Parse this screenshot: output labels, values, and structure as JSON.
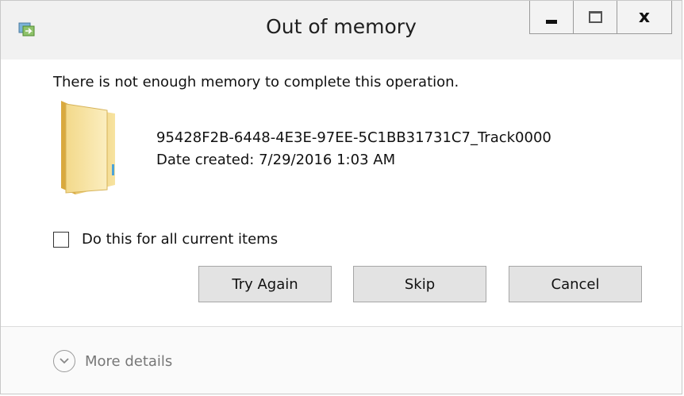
{
  "window": {
    "title": "Out of memory",
    "app_icon": "copy-transfer-icon"
  },
  "caption_buttons": {
    "minimize_icon": "minimize-icon",
    "maximize_icon": "maximize-icon",
    "close_label": "x"
  },
  "body": {
    "message": "There is not enough memory to complete this operation.",
    "file_icon": "folder-icon",
    "file_name": "95428F2B-6448-4E3E-97EE-5C1BB31731C7_Track0000",
    "date_created": "Date created: 7/29/2016 1:03 AM"
  },
  "options": {
    "apply_all_label": "Do this for all current items",
    "apply_all_checked": false
  },
  "buttons": {
    "try_again": "Try Again",
    "skip": "Skip",
    "cancel": "Cancel"
  },
  "footer": {
    "more_details": "More details",
    "expand_icon": "chevron-down-circle-icon"
  },
  "colors": {
    "titlebar_bg": "#f1f1f1",
    "button_bg": "#e3e3e3",
    "button_border": "#a6a6a6",
    "footer_text": "#777777"
  }
}
